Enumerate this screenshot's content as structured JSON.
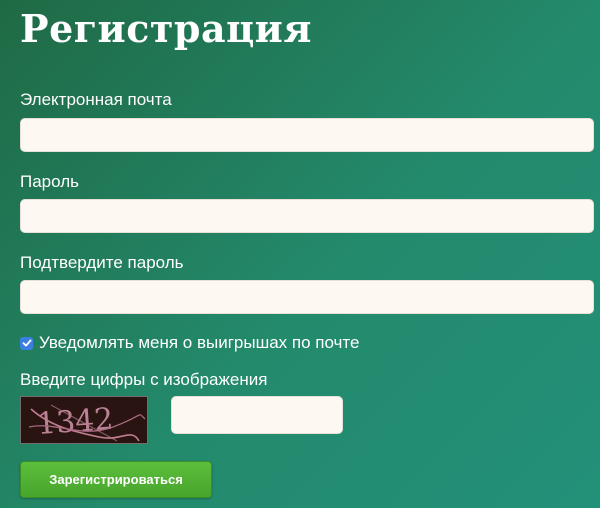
{
  "page": {
    "title": "Регистрация"
  },
  "form": {
    "email_label": "Электронная почта",
    "email_value": "",
    "password_label": "Пароль",
    "password_value": "",
    "confirm_label": "Подтвердите пароль",
    "confirm_value": "",
    "notify_label": "Уведомлять меня о выигрышах по почте",
    "notify_checked": true,
    "captcha_label": "Введите цифры с изображения",
    "captcha_text": "1342",
    "captcha_value": "",
    "submit_label": "Зарегистрироваться"
  },
  "colors": {
    "background_start": "#1f6a45",
    "background_end": "#239079",
    "field_fill": "#fdf8f2",
    "checkbox_accent": "#3b80e0",
    "button_green": "#52b535",
    "captcha_background": "#2a1412",
    "captcha_text": "#b07d90"
  },
  "icons": {
    "checkbox": "checkmark-icon"
  }
}
